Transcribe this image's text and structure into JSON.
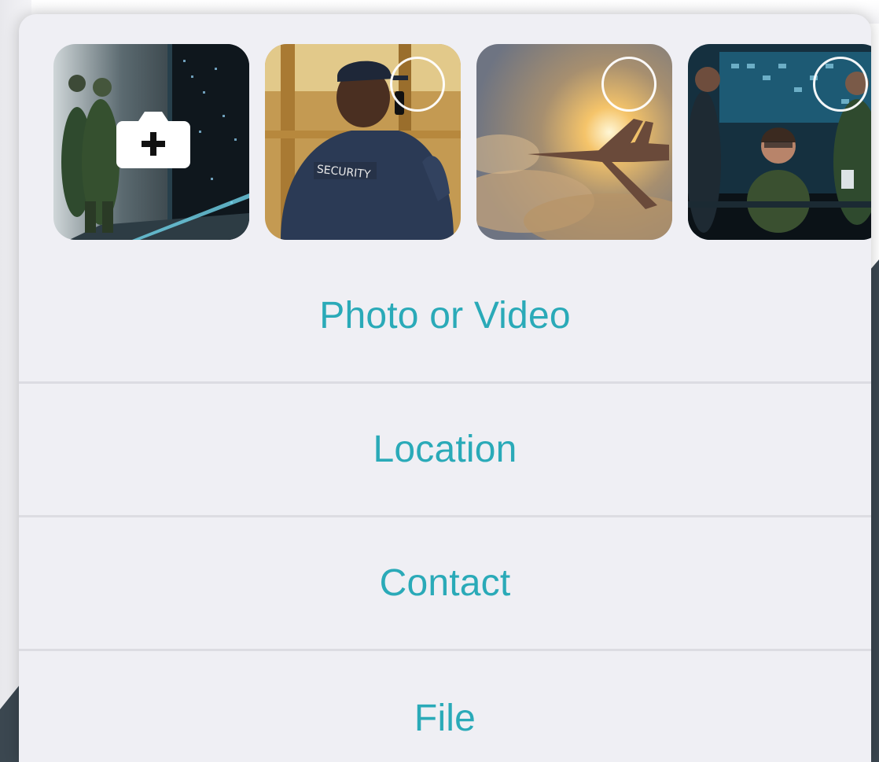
{
  "colors": {
    "accent": "#2aaab8",
    "sheet_background": "#efeff4",
    "divider": "#dcdce2"
  },
  "gallery": {
    "items": [
      {
        "kind": "camera",
        "icon": "camera-plus-icon",
        "scene": "soldiers-in-server-room"
      },
      {
        "kind": "photo",
        "scene": "security-guard-with-radio",
        "printed_text": "SECURITY"
      },
      {
        "kind": "photo",
        "scene": "fighter-jet-in-clouds"
      },
      {
        "kind": "photo",
        "scene": "people-in-control-room"
      }
    ]
  },
  "menu": {
    "items": [
      {
        "label": "Photo or Video"
      },
      {
        "label": "Location"
      },
      {
        "label": "Contact"
      },
      {
        "label": "File"
      }
    ]
  }
}
